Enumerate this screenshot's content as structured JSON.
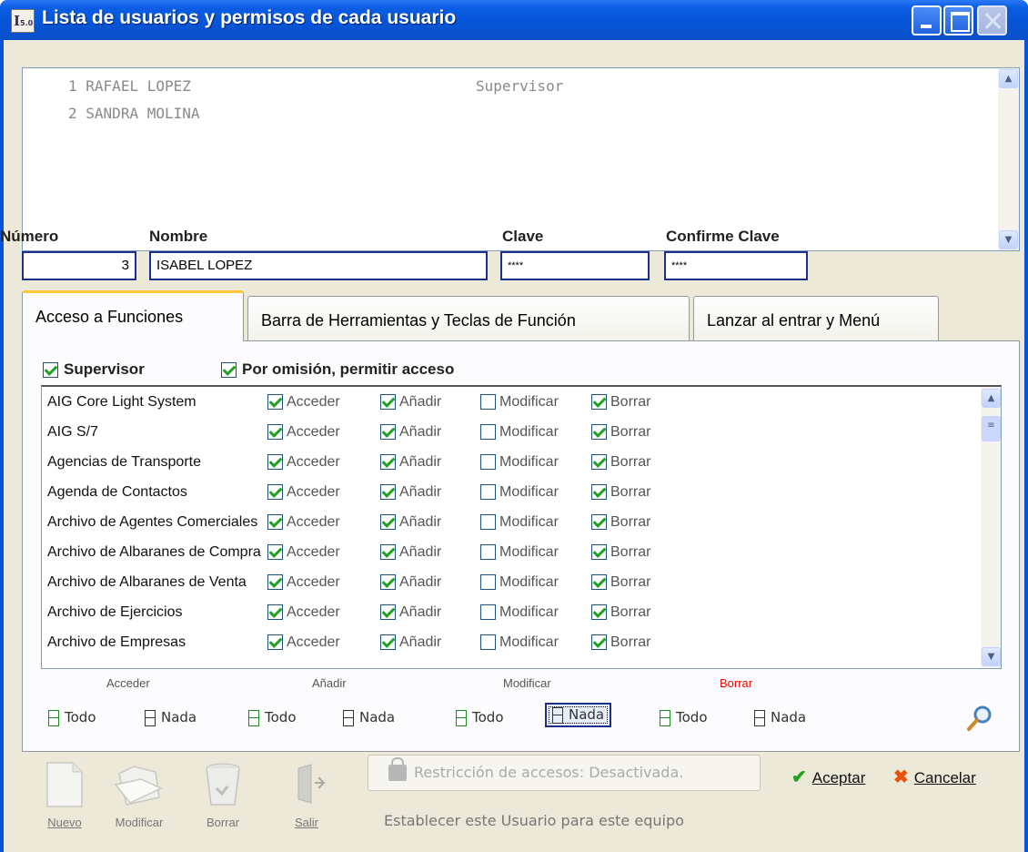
{
  "window": {
    "title": "Lista de usuarios y permisos de cada usuario",
    "icon_text": "I",
    "icon_sub": "5.0"
  },
  "users": [
    {
      "num": "1",
      "name": "RAFAEL LOPEZ",
      "role": "Supervisor"
    },
    {
      "num": "2",
      "name": "SANDRA MOLINA",
      "role": ""
    }
  ],
  "form": {
    "numero_label": "Número",
    "numero_value": "3",
    "nombre_label": "Nombre",
    "nombre_value": "ISABEL LOPEZ",
    "clave_label": "Clave",
    "clave_value": "****",
    "confirme_label": "Confirme Clave",
    "confirme_value": "****"
  },
  "tabs": [
    {
      "label": "Acceso a Funciones"
    },
    {
      "label": "Barra de Herramientas y Teclas de Función"
    },
    {
      "label": "Lanzar al entrar y Menú"
    }
  ],
  "options": {
    "supervisor": "Supervisor",
    "default_access": "Por omisión, permitir acceso"
  },
  "permissions": {
    "labels": {
      "acceder": "Acceder",
      "anadir": "Añadir",
      "modificar": "Modificar",
      "borrar": "Borrar"
    },
    "rows": [
      {
        "fn": "AIG Core Light System"
      },
      {
        "fn": "AIG S/7"
      },
      {
        "fn": "Agencias de Transporte"
      },
      {
        "fn": "Agenda de Contactos"
      },
      {
        "fn": "Archivo de Agentes Comerciales"
      },
      {
        "fn": "Archivo de Albaranes de Compra"
      },
      {
        "fn": "Archivo de Albaranes de Venta"
      },
      {
        "fn": "Archivo de Ejercicios"
      },
      {
        "fn": "Archivo de Empresas"
      }
    ]
  },
  "bulk": {
    "acceder": "Acceder",
    "anadir": "Añadir",
    "modificar": "Modificar",
    "borrar": "Borrar",
    "todo": "Todo",
    "nada": "Nada",
    "borrar_color": "#ff0000"
  },
  "toolbar": {
    "nuevo": "Nuevo",
    "modificar": "Modificar",
    "borrar": "Borrar",
    "salir": "Salir"
  },
  "restrict_button": "Restricción de accesos: Desactivada.",
  "establecer": "Establecer este Usuario para este equipo",
  "actions": {
    "aceptar": "Aceptar",
    "cancelar": "Cancelar"
  },
  "colors": {
    "titlebar": "#0654d6",
    "face": "#ece9d8",
    "tab_highlight": "#ffc83c"
  }
}
